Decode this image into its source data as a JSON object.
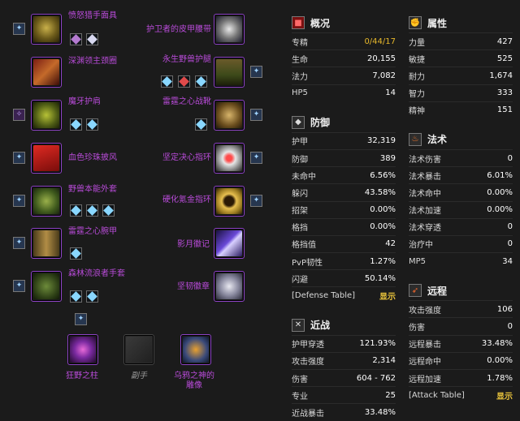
{
  "items": {
    "head": "愤怒猎手面具",
    "neck": "深渊领主颈圈",
    "shoulder": "魔牙护肩",
    "back": "血色珍珠披风",
    "chest": "野兽本能外套",
    "wrist": "雷霆之心腕甲",
    "hands": "森林流浪者手套",
    "waist": "护卫者的皮甲腰带",
    "legs": "永生野兽护腿",
    "feet": "雷霆之心战靴",
    "ring1": "坚定决心指环",
    "ring2": "硬化氪金指环",
    "trinket1": "影月徽记",
    "trinket2": "坚韧徽章",
    "mainhand": "狂野之柱",
    "offhand": "副手",
    "ranged": "乌鸦之神的雕像"
  },
  "colors": {
    "epic": "#b84bd8",
    "gold": "#e8b92b",
    "bg": "#1b1b1b"
  },
  "overview": {
    "title": "概况",
    "rows": [
      {
        "label": "专精",
        "value": "0/44/17"
      },
      {
        "label": "生命",
        "value": "20,155"
      },
      {
        "label": "法力",
        "value": "7,082"
      },
      {
        "label": "HP5",
        "value": "14"
      }
    ]
  },
  "defense": {
    "title": "防御",
    "rows": [
      {
        "label": "护甲",
        "value": "32,319"
      },
      {
        "label": "防御",
        "value": "389"
      },
      {
        "label": "未命中",
        "value": "6.56%"
      },
      {
        "label": "躲闪",
        "value": "43.58%"
      },
      {
        "label": "招架",
        "value": "0.00%"
      },
      {
        "label": "格挡",
        "value": "0.00%"
      },
      {
        "label": "格挡值",
        "value": "42"
      },
      {
        "label": "PvP韧性",
        "value": "1.27%"
      },
      {
        "label": "闪避",
        "value": "50.14%"
      },
      {
        "label": "[Defense Table]",
        "value": "显示"
      }
    ]
  },
  "melee": {
    "title": "近战",
    "rows": [
      {
        "label": "护甲穿透",
        "value": "121.93%"
      },
      {
        "label": "攻击强度",
        "value": "2,314"
      },
      {
        "label": "伤害",
        "value": "604 - 762"
      },
      {
        "label": "专业",
        "value": "25"
      },
      {
        "label": "近战暴击",
        "value": "33.48%"
      }
    ]
  },
  "attributes": {
    "title": "属性",
    "rows": [
      {
        "label": "力量",
        "value": "427"
      },
      {
        "label": "敏捷",
        "value": "525"
      },
      {
        "label": "耐力",
        "value": "1,674"
      },
      {
        "label": "智力",
        "value": "333"
      },
      {
        "label": "精神",
        "value": "151"
      }
    ]
  },
  "spell": {
    "title": "法术",
    "rows": [
      {
        "label": "法术伤害",
        "value": "0"
      },
      {
        "label": "法术暴击",
        "value": "6.01%"
      },
      {
        "label": "法术命中",
        "value": "0.00%"
      },
      {
        "label": "法术加速",
        "value": "0.00%"
      },
      {
        "label": "法术穿透",
        "value": "0"
      },
      {
        "label": "治疗中",
        "value": "0"
      },
      {
        "label": "MP5",
        "value": "34"
      }
    ]
  },
  "ranged_stats": {
    "title": "远程",
    "rows": [
      {
        "label": "攻击强度",
        "value": "106"
      },
      {
        "label": "伤害",
        "value": "0"
      },
      {
        "label": "远程暴击",
        "value": "33.48%"
      },
      {
        "label": "远程命中",
        "value": "0.00%"
      },
      {
        "label": "远程加速",
        "value": "1.78%"
      },
      {
        "label": "[Attack Table]",
        "value": "显示"
      }
    ]
  }
}
